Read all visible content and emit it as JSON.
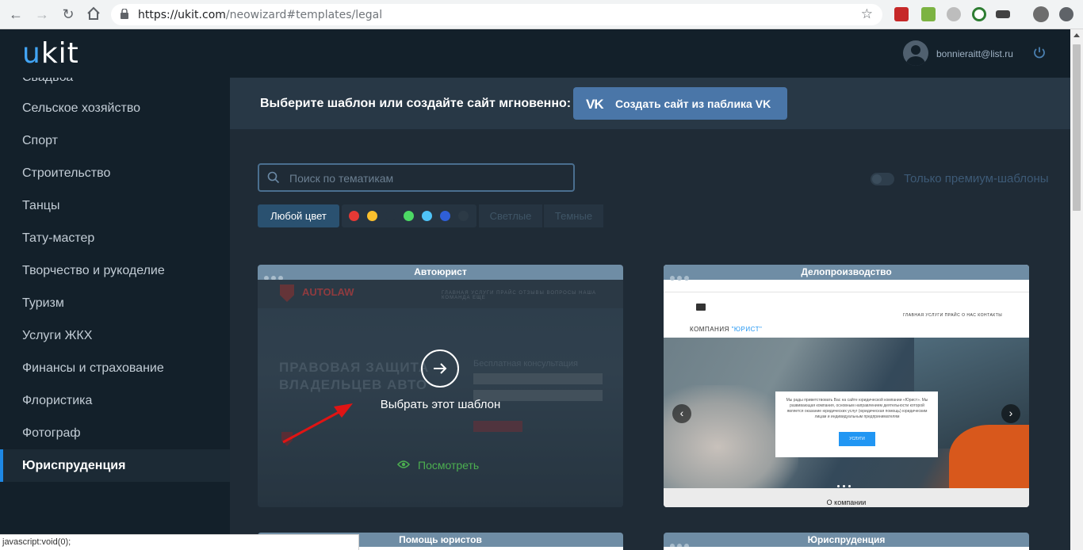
{
  "browser": {
    "url_host": "https://ukit.com",
    "url_path": "/neowizard#templates/legal"
  },
  "header": {
    "logo_u": "u",
    "logo_rest": "kit",
    "user_email": "bonnieraitt@list.ru"
  },
  "sidebar": {
    "items": [
      {
        "label": "Свадьба"
      },
      {
        "label": "Сельское хозяйство"
      },
      {
        "label": "Спорт"
      },
      {
        "label": "Строительство"
      },
      {
        "label": "Танцы"
      },
      {
        "label": "Тату-мастер"
      },
      {
        "label": "Творчество и рукоделие"
      },
      {
        "label": "Туризм"
      },
      {
        "label": "Услуги ЖКХ"
      },
      {
        "label": "Финансы и страхование"
      },
      {
        "label": "Флористика"
      },
      {
        "label": "Фотограф"
      },
      {
        "label": "Юриспруденция"
      }
    ],
    "active": "Юриспруденция"
  },
  "main": {
    "prompt": "Выберите шаблон или создайте сайт мгновенно:",
    "vk_button": "Создать сайт из паблика VK",
    "vk_logo": "VK",
    "search_placeholder": "Поиск по тематикам",
    "premium_label": "Только премиум-шаблоны",
    "premium_enabled": false,
    "filters": {
      "any_color": "Любой цвет",
      "light": "Светлые",
      "dark": "Темные",
      "colors": [
        "#e53935",
        "#fbc02d",
        "#263441",
        "#4cd964",
        "#4fc3f7",
        "#2f5fd8",
        "#2c3a46"
      ]
    }
  },
  "templates": [
    {
      "title": "Автоюрист",
      "preview": {
        "logo": "AUTOLAW",
        "nav": "ГЛАВНАЯ УСЛУГИ ПРАЙС ОТЗЫВЫ ВОПРОСЫ НАША КОМАНДА ЕЩЕ",
        "hero_line1": "ПРАВОВАЯ ЗАЩИТА",
        "hero_line2": "ВЛАДЕЛЬЦЕВ АВТО",
        "form_label": "Бесплатная консультация"
      },
      "choose_label": "Выбрать этот шаблон",
      "view_label": "Посмотреть"
    },
    {
      "title": "Делопроизводство",
      "preview": {
        "company_prefix": "КОМПАНИЯ ",
        "company_name": "\"ЮРИСТ\"",
        "nav": "ГЛАВНАЯ   УСЛУГИ   ПРАЙС   О НАС   КОНТАКТЫ",
        "popup_text": "Мы рады приветствовать Вас на сайте юридической компании «Юрист». Мы развивающая компания, основным направлением деятельности которой является оказание юридических услуг (юридическая помощь) юридическим лицам и индивидуальным предпринимателям",
        "popup_button": "УСЛУГИ",
        "footer": "О компании"
      }
    },
    {
      "title": "Помощь юристов"
    },
    {
      "title": "Юриспруденция"
    }
  ],
  "statusbar": "javascript:void(0);",
  "colors": {
    "accent": "#1e88e5",
    "vk": "#4a76a8",
    "view_link": "#4caf50"
  }
}
